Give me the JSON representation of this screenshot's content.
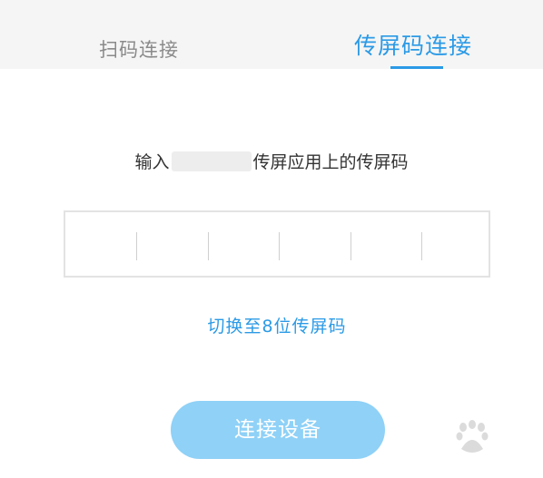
{
  "tabs": [
    {
      "label": "扫码连接",
      "active": false
    },
    {
      "label": "传屏码连接",
      "active": true
    }
  ],
  "prompt": {
    "before": "输入",
    "after": "传屏应用上的传屏码"
  },
  "code_input": {
    "value": ""
  },
  "switch_link": "切换至8位传屏码",
  "connect_button": "连接设备",
  "colors": {
    "accent": "#2b9ae6",
    "button_bg": "#8fd1f7",
    "tabbar_bg": "#f5f5f5",
    "inactive_tab": "#8a8a8a"
  }
}
